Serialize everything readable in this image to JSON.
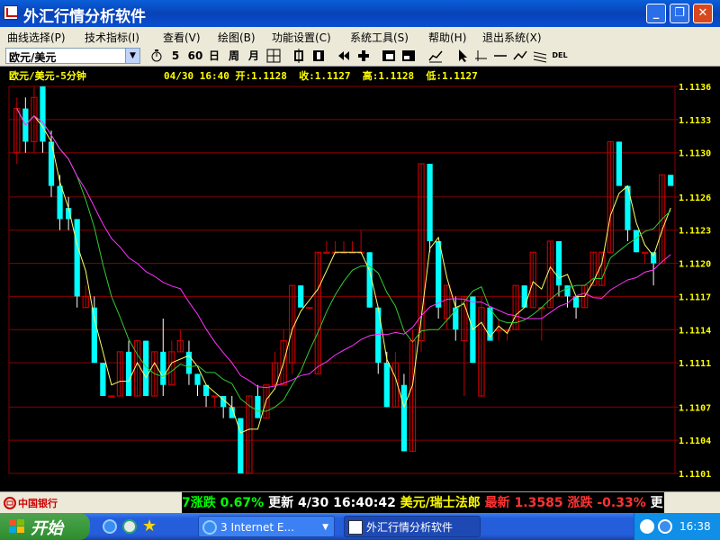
{
  "window": {
    "title": "外汇行情分析软件",
    "controls": {
      "minimize": "_",
      "maximize": "❐",
      "close": "✕"
    }
  },
  "menu": [
    {
      "label": "曲线选择(P)"
    },
    {
      "label": "技术指标(I)"
    },
    {
      "label": "查看(V)"
    },
    {
      "label": "绘图(B)"
    },
    {
      "label": "功能设置(C)"
    },
    {
      "label": "系统工具(S)"
    },
    {
      "label": "帮助(H)"
    },
    {
      "label": "退出系统(X)"
    }
  ],
  "toolbar": {
    "symbol_value": "欧元/美元",
    "periods": [
      "5",
      "60",
      "日",
      "周",
      "月"
    ],
    "del_label": "DEL"
  },
  "chart_header": {
    "symbol_period": "欧元/美元-5分钟",
    "date": "04/30",
    "time": "16:40",
    "open_label": "开:",
    "open": "1.1128",
    "close_label": "收:",
    "close": "1.1127",
    "high_label": "高:",
    "high": "1.1128",
    "low_label": "低:",
    "low": "1.1127"
  },
  "colors": {
    "up": "#c00000",
    "down": "#00ffff",
    "ma_short": "#ffff66",
    "ma_mid": "#33cc33",
    "ma_long": "#ff33ff",
    "grid": "#8b0000",
    "axis_text": "#ffff00"
  },
  "chart_data": {
    "type": "candlestick",
    "y_ticks": [
      "1.1136",
      "1.1133",
      "1.1130",
      "1.1126",
      "1.1123",
      "1.1120",
      "1.1117",
      "1.1114",
      "1.1111",
      "1.1107",
      "1.1104",
      "1.1101"
    ],
    "ylim": [
      1.1101,
      1.1136
    ],
    "candles": [
      {
        "o": 1.113,
        "c": 1.1134,
        "h": 1.1135,
        "l": 1.1129
      },
      {
        "o": 1.1134,
        "c": 1.1131,
        "h": 1.1135,
        "l": 1.113
      },
      {
        "o": 1.1131,
        "c": 1.1135,
        "h": 1.1136,
        "l": 1.113
      },
      {
        "o": 1.1136,
        "c": 1.1131,
        "h": 1.1136,
        "l": 1.113
      },
      {
        "o": 1.1131,
        "c": 1.1127,
        "h": 1.1132,
        "l": 1.1126
      },
      {
        "o": 1.1127,
        "c": 1.1124,
        "h": 1.1128,
        "l": 1.1123
      },
      {
        "o": 1.1125,
        "c": 1.1124,
        "h": 1.1126,
        "l": 1.1123
      },
      {
        "o": 1.1124,
        "c": 1.1117,
        "h": 1.1124,
        "l": 1.1116
      },
      {
        "o": 1.1116,
        "c": 1.1117,
        "h": 1.1118,
        "l": 1.1116
      },
      {
        "o": 1.1116,
        "c": 1.1111,
        "h": 1.1117,
        "l": 1.1111
      },
      {
        "o": 1.1111,
        "c": 1.1108,
        "h": 1.1111,
        "l": 1.1108
      },
      {
        "o": 1.1108,
        "c": 1.1108,
        "h": 1.1108,
        "l": 1.1108
      },
      {
        "o": 1.1108,
        "c": 1.1112,
        "h": 1.1112,
        "l": 1.1108
      },
      {
        "o": 1.1112,
        "c": 1.1108,
        "h": 1.1113,
        "l": 1.1108
      },
      {
        "o": 1.1108,
        "c": 1.1113,
        "h": 1.1113,
        "l": 1.1108
      },
      {
        "o": 1.1113,
        "c": 1.1108,
        "h": 1.1113,
        "l": 1.1108
      },
      {
        "o": 1.1108,
        "c": 1.1112,
        "h": 1.1112,
        "l": 1.1108
      },
      {
        "o": 1.1112,
        "c": 1.1109,
        "h": 1.1115,
        "l": 1.1108
      },
      {
        "o": 1.1109,
        "c": 1.1112,
        "h": 1.1113,
        "l": 1.1109
      },
      {
        "o": 1.1112,
        "c": 1.1113,
        "h": 1.1114,
        "l": 1.1112
      },
      {
        "o": 1.1112,
        "c": 1.111,
        "h": 1.1113,
        "l": 1.1109
      },
      {
        "o": 1.111,
        "c": 1.1109,
        "h": 1.111,
        "l": 1.1108
      },
      {
        "o": 1.1109,
        "c": 1.1108,
        "h": 1.1109,
        "l": 1.1107
      },
      {
        "o": 1.1108,
        "c": 1.1108,
        "h": 1.1108,
        "l": 1.1107
      },
      {
        "o": 1.1108,
        "c": 1.1107,
        "h": 1.1108,
        "l": 1.1106
      },
      {
        "o": 1.1107,
        "c": 1.1106,
        "h": 1.1108,
        "l": 1.1106
      },
      {
        "o": 1.1106,
        "c": 1.1101,
        "h": 1.1106,
        "l": 1.1101
      },
      {
        "o": 1.1101,
        "c": 1.1108,
        "h": 1.1108,
        "l": 1.1101
      },
      {
        "o": 1.1108,
        "c": 1.1106,
        "h": 1.1109,
        "l": 1.1106
      },
      {
        "o": 1.1106,
        "c": 1.1109,
        "h": 1.1109,
        "l": 1.1106
      },
      {
        "o": 1.1109,
        "c": 1.1111,
        "h": 1.1112,
        "l": 1.1109
      },
      {
        "o": 1.1109,
        "c": 1.1113,
        "h": 1.1114,
        "l": 1.1109
      },
      {
        "o": 1.1111,
        "c": 1.1118,
        "h": 1.1118,
        "l": 1.111
      },
      {
        "o": 1.1118,
        "c": 1.1116,
        "h": 1.1118,
        "l": 1.1116
      },
      {
        "o": 1.1116,
        "c": 1.1116,
        "h": 1.1116,
        "l": 1.1116
      },
      {
        "o": 1.111,
        "c": 1.1121,
        "h": 1.1121,
        "l": 1.111
      },
      {
        "o": 1.1121,
        "c": 1.1121,
        "h": 1.1122,
        "l": 1.1121
      },
      {
        "o": 1.1121,
        "c": 1.1121,
        "h": 1.1122,
        "l": 1.1121
      },
      {
        "o": 1.1121,
        "c": 1.1121,
        "h": 1.1122,
        "l": 1.1121
      },
      {
        "o": 1.1121,
        "c": 1.1121,
        "h": 1.1122,
        "l": 1.1121
      },
      {
        "o": 1.1121,
        "c": 1.1121,
        "h": 1.1123,
        "l": 1.1121
      },
      {
        "o": 1.1121,
        "c": 1.1116,
        "h": 1.1121,
        "l": 1.1116
      },
      {
        "o": 1.1116,
        "c": 1.1111,
        "h": 1.1116,
        "l": 1.111
      },
      {
        "o": 1.1111,
        "c": 1.1107,
        "h": 1.1112,
        "l": 1.1107
      },
      {
        "o": 1.1107,
        "c": 1.1111,
        "h": 1.1112,
        "l": 1.1107
      },
      {
        "o": 1.1109,
        "c": 1.1103,
        "h": 1.111,
        "l": 1.1103
      },
      {
        "o": 1.1103,
        "c": 1.1113,
        "h": 1.1114,
        "l": 1.1103
      },
      {
        "o": 1.1113,
        "c": 1.1129,
        "h": 1.1129,
        "l": 1.1112
      },
      {
        "o": 1.1129,
        "c": 1.1122,
        "h": 1.1129,
        "l": 1.1121
      },
      {
        "o": 1.1122,
        "c": 1.1116,
        "h": 1.1122,
        "l": 1.1115
      },
      {
        "o": 1.1115,
        "c": 1.1118,
        "h": 1.1118,
        "l": 1.1114
      },
      {
        "o": 1.1116,
        "c": 1.1114,
        "h": 1.1117,
        "l": 1.1113
      },
      {
        "o": 1.1113,
        "c": 1.1117,
        "h": 1.1117,
        "l": 1.1108
      },
      {
        "o": 1.1117,
        "c": 1.1111,
        "h": 1.1117,
        "l": 1.1111
      },
      {
        "o": 1.1108,
        "c": 1.1116,
        "h": 1.1117,
        "l": 1.1108
      },
      {
        "o": 1.1116,
        "c": 1.1113,
        "h": 1.1116,
        "l": 1.1113
      },
      {
        "o": 1.1114,
        "c": 1.1114,
        "h": 1.1115,
        "l": 1.1113
      },
      {
        "o": 1.1114,
        "c": 1.1114,
        "h": 1.1114,
        "l": 1.1113
      },
      {
        "o": 1.1114,
        "c": 1.1118,
        "h": 1.1118,
        "l": 1.1114
      },
      {
        "o": 1.1118,
        "c": 1.1116,
        "h": 1.1118,
        "l": 1.1116
      },
      {
        "o": 1.1116,
        "c": 1.1121,
        "h": 1.1121,
        "l": 1.1116
      },
      {
        "o": 1.1116,
        "c": 1.1116,
        "h": 1.1116,
        "l": 1.1113
      },
      {
        "o": 1.1116,
        "c": 1.1122,
        "h": 1.1122,
        "l": 1.1116
      },
      {
        "o": 1.1122,
        "c": 1.1118,
        "h": 1.1122,
        "l": 1.1117
      },
      {
        "o": 1.1118,
        "c": 1.1117,
        "h": 1.1118,
        "l": 1.1116
      },
      {
        "o": 1.1117,
        "c": 1.1116,
        "h": 1.1117,
        "l": 1.1115
      },
      {
        "o": 1.1116,
        "c": 1.1118,
        "h": 1.1118,
        "l": 1.1116
      },
      {
        "o": 1.1118,
        "c": 1.1121,
        "h": 1.1121,
        "l": 1.1118
      },
      {
        "o": 1.1118,
        "c": 1.1121,
        "h": 1.1121,
        "l": 1.1118
      },
      {
        "o": 1.1121,
        "c": 1.1131,
        "h": 1.1131,
        "l": 1.1121
      },
      {
        "o": 1.1131,
        "c": 1.1127,
        "h": 1.1131,
        "l": 1.1127
      },
      {
        "o": 1.1127,
        "c": 1.1123,
        "h": 1.1127,
        "l": 1.1122
      },
      {
        "o": 1.1123,
        "c": 1.1121,
        "h": 1.1123,
        "l": 1.1121
      },
      {
        "o": 1.1121,
        "c": 1.1121,
        "h": 1.1121,
        "l": 1.112
      },
      {
        "o": 1.1121,
        "c": 1.112,
        "h": 1.1121,
        "l": 1.1118
      },
      {
        "o": 1.112,
        "c": 1.1128,
        "h": 1.1128,
        "l": 1.112
      },
      {
        "o": 1.1128,
        "c": 1.1127,
        "h": 1.1128,
        "l": 1.1127
      }
    ]
  },
  "ticker": {
    "logo": "中国银行",
    "segments": [
      {
        "text": "7",
        "color": "#00ff00"
      },
      {
        "text": "涨跌",
        "color": "#00ff00"
      },
      {
        "text": " 0.67%",
        "color": "#00ff00"
      },
      {
        "text": " 更新",
        "color": "#ffffff"
      },
      {
        "text": " 4/30 16:40:42",
        "color": "#ffffff"
      },
      {
        "text": " 美元/瑞士法郎",
        "color": "#ffff00"
      },
      {
        "text": " 最新",
        "color": "#ff3333"
      },
      {
        "text": " 1.3585",
        "color": "#ff3333"
      },
      {
        "text": " 涨跌",
        "color": "#ff3333"
      },
      {
        "text": " -0.33%",
        "color": "#ff3333"
      },
      {
        "text": " 更",
        "color": "#ffffff"
      }
    ]
  },
  "taskbar": {
    "start_label": "开始",
    "ie_task": "3 Internet E...",
    "app_task": "外汇行情分析软件",
    "clock": "16:38"
  }
}
